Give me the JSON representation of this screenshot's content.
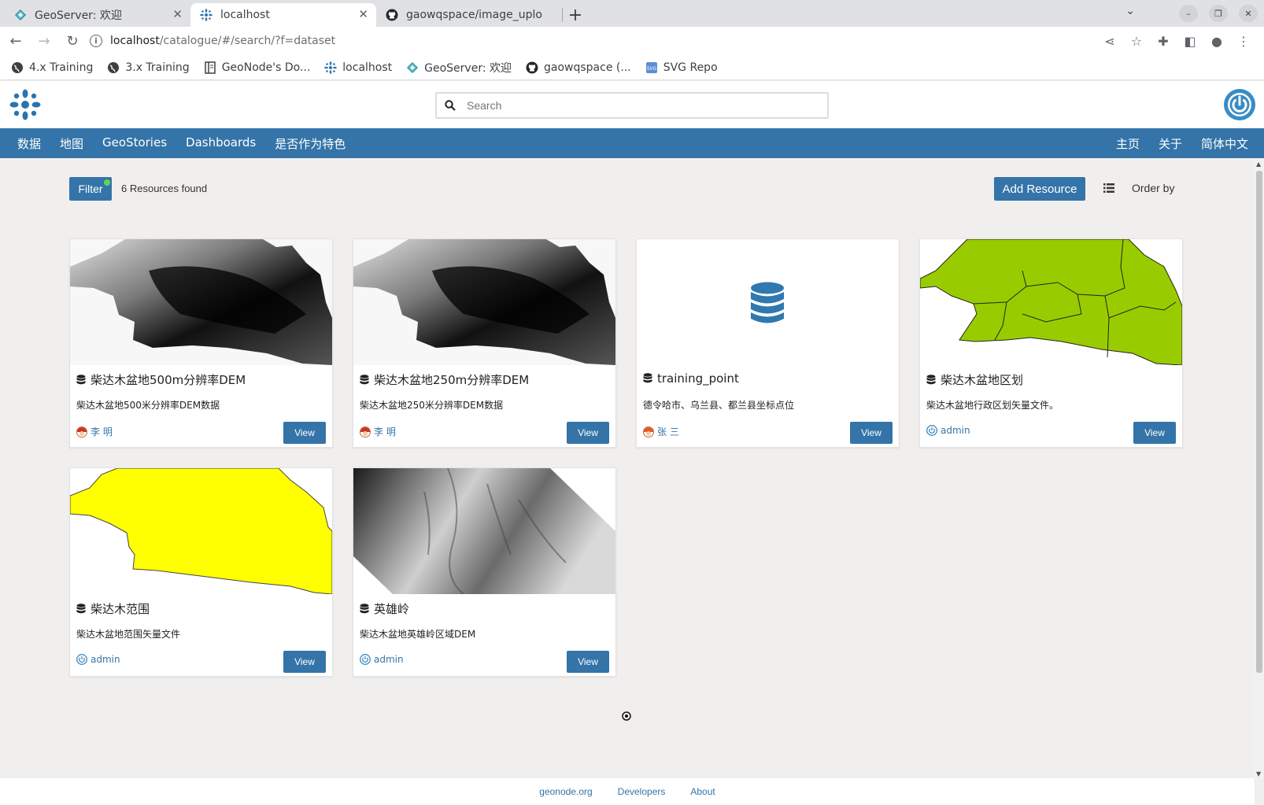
{
  "browser": {
    "tabs": [
      {
        "title": "GeoServer: 欢迎",
        "icon": "geoserver-icon"
      },
      {
        "title": "localhost",
        "icon": "geonode-icon"
      },
      {
        "title": "gaowqspace/image_uplo",
        "icon": "github-icon"
      }
    ],
    "url_host": "localhost",
    "url_path": "/catalogue/#/search/?f=dataset",
    "bookmarks": [
      {
        "label": "4.x Training",
        "icon": "globe-icon"
      },
      {
        "label": "3.x Training",
        "icon": "globe-icon"
      },
      {
        "label": "GeoNode's Do...",
        "icon": "book-icon"
      },
      {
        "label": "localhost",
        "icon": "geonode-icon"
      },
      {
        "label": "GeoServer: 欢迎",
        "icon": "geoserver-icon"
      },
      {
        "label": "gaowqspace (...",
        "icon": "github-icon"
      },
      {
        "label": "SVG Repo",
        "icon": "svgrepo-icon"
      }
    ]
  },
  "header": {
    "search_placeholder": "Search"
  },
  "nav": {
    "left": [
      "数据",
      "地图",
      "GeoStories",
      "Dashboards",
      "是否作为特色"
    ],
    "right": [
      "主页",
      "关于",
      "简体中文"
    ]
  },
  "toolbar": {
    "filter_label": "Filter",
    "found_text": "6 Resources found",
    "add_resource_label": "Add Resource",
    "order_by_label": "Order by"
  },
  "cards": [
    {
      "title": "柴达木盆地500m分辨率DEM",
      "desc": "柴达木盆地500米分辨率DEM数据",
      "owner": "李 明",
      "owner_avatar": "user-avatar-icon",
      "view": "View",
      "thumb": "dem-grayscale"
    },
    {
      "title": "柴达木盆地250m分辨率DEM",
      "desc": "柴达木盆地250米分辨率DEM数据",
      "owner": "李 明",
      "owner_avatar": "user-avatar-icon",
      "view": "View",
      "thumb": "dem-grayscale"
    },
    {
      "title": "training_point",
      "desc": "德令哈市、乌兰县、都兰县坐标点位",
      "owner": "张 三",
      "owner_avatar": "user-avatar-icon",
      "view": "View",
      "thumb": "database-icon"
    },
    {
      "title": "柴达木盆地区划",
      "desc": "柴达木盆地行政区划矢量文件。",
      "owner": "admin",
      "owner_avatar": "power-icon",
      "view": "View",
      "thumb": "green-regions"
    },
    {
      "title": "柴达木范围",
      "desc": "柴达木盆地范围矢量文件",
      "owner": "admin",
      "owner_avatar": "power-icon",
      "view": "View",
      "thumb": "yellow-extent"
    },
    {
      "title": "英雄岭",
      "desc": "柴达木盆地英雄岭区域DEM",
      "owner": "admin",
      "owner_avatar": "power-icon",
      "view": "View",
      "thumb": "dem-rotated"
    }
  ],
  "footer": {
    "links": [
      "geonode.org",
      "Developers",
      "About"
    ]
  },
  "colors": {
    "brand": "#3474a8",
    "region_green": "#99cc00",
    "extent_yellow": "#ffff00",
    "background": "#f1efee"
  }
}
